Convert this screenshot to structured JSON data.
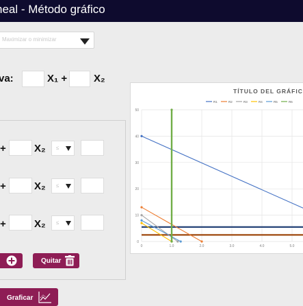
{
  "window": {
    "title": "neal - Método gráfico"
  },
  "method_select": {
    "placeholder": "Maximizar o minimizar"
  },
  "objective": {
    "label": "va:",
    "x1": "X₁ +",
    "x2": "X₂"
  },
  "constraints": [
    {
      "x2": "X₂",
      "op": "≤",
      "plus": "+"
    },
    {
      "x2": "X₂",
      "op": "≤",
      "plus": "+"
    },
    {
      "x2": "X₂",
      "op": "≤",
      "plus": "+"
    }
  ],
  "buttons": {
    "add_icon": "plus-circle-icon",
    "remove_label": "Quitar",
    "graph_label": "Graficar"
  },
  "chart_data": {
    "type": "line",
    "title": "TÍTULO DEL GRÁFICO",
    "legend": [
      "R1",
      "R2",
      "R3",
      "R4",
      "R5",
      "R6"
    ],
    "colors": [
      "#4472c4",
      "#ed7d31",
      "#a5a5a5",
      "#ffc000",
      "#5b9bd5",
      "#70ad47"
    ],
    "xlim": [
      0,
      5.5
    ],
    "ylim": [
      0,
      50
    ],
    "x_ticks": [
      "0",
      "1.0",
      "2.0",
      "3.0",
      "4.0",
      "5.0"
    ],
    "y_ticks": [
      "0",
      "10",
      "20",
      "30",
      "40",
      "50"
    ],
    "series": [
      {
        "name": "R1",
        "x": [
          0,
          5.5
        ],
        "y": [
          40,
          12
        ]
      },
      {
        "name": "R2",
        "x": [
          0,
          2.0
        ],
        "y": [
          13,
          0
        ]
      },
      {
        "name": "R3",
        "x": [
          0,
          1.2
        ],
        "y": [
          10,
          0
        ]
      },
      {
        "name": "R4",
        "x": [
          0,
          1.0
        ],
        "y": [
          7,
          0
        ]
      },
      {
        "name": "R5",
        "x": [
          0,
          1.3
        ],
        "y": [
          8,
          0
        ]
      },
      {
        "name": "R6",
        "x": [
          1.0,
          1.0
        ],
        "y": [
          0,
          50
        ]
      }
    ],
    "hlines": [
      {
        "y": 5.5,
        "color": "#264478"
      },
      {
        "y": 2.5,
        "color": "#9e480e"
      }
    ]
  }
}
